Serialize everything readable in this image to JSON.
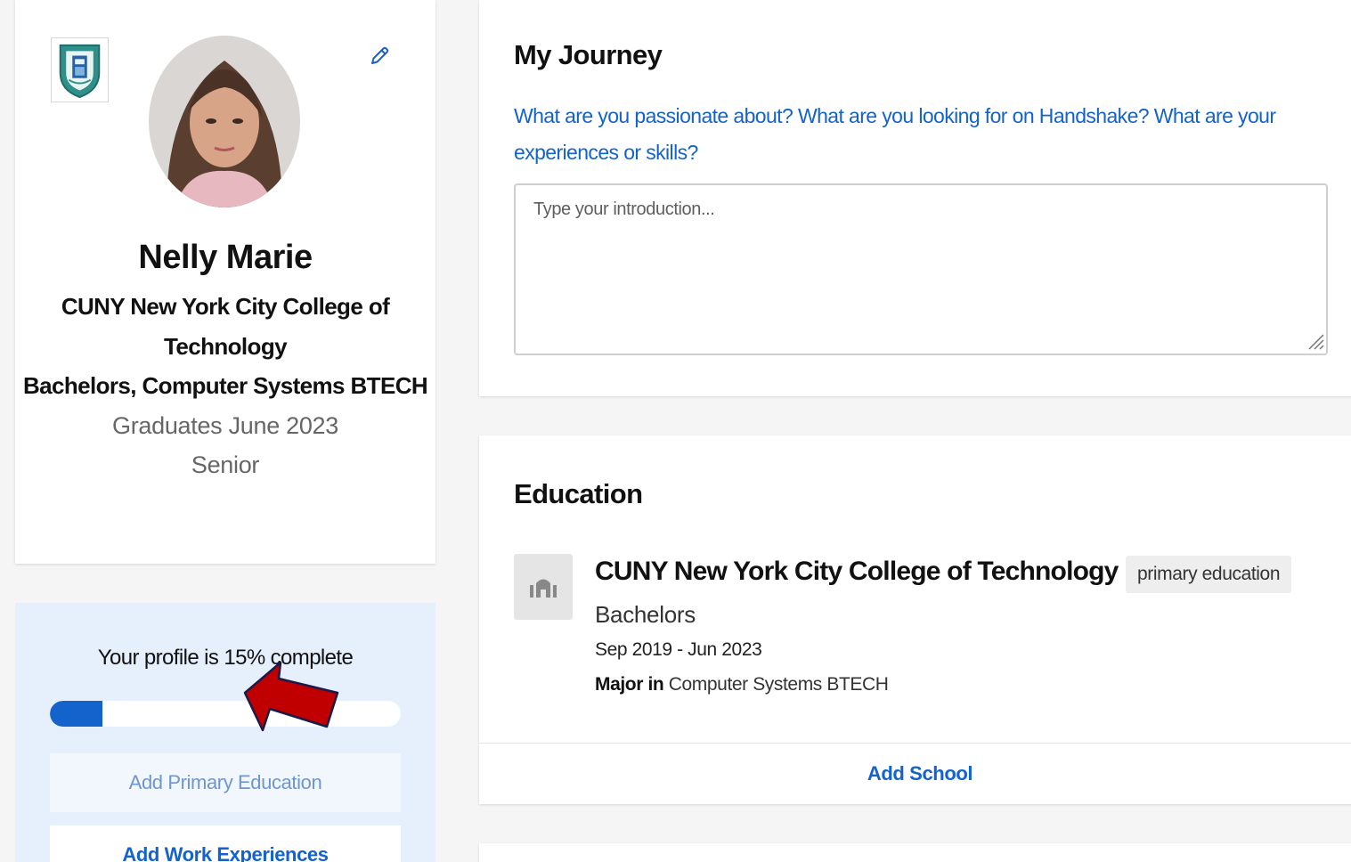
{
  "profile": {
    "name": "Nelly Marie",
    "school": "CUNY New York City College of Technology",
    "degree_major": "Bachelors, Computer Systems BTECH",
    "graduation": "Graduates June 2023",
    "class_year": "Senior",
    "edit_icon": "pencil-icon"
  },
  "completion": {
    "label": "Your profile is 15% complete",
    "percent": 15,
    "tasks": [
      "Add Primary Education",
      "Add Work Experiences"
    ]
  },
  "journey": {
    "title": "My Journey",
    "prompt": "What are you passionate about? What are you looking for on Handshake? What are your experiences or skills?",
    "placeholder": "Type your introduction..."
  },
  "education": {
    "title": "Education",
    "entries": [
      {
        "school": "CUNY New York City College of Technology",
        "tag": "primary education",
        "degree": "Bachelors",
        "dates": "Sep 2019 - Jun 2023",
        "major_prefix": "Major in",
        "major": "Computer Systems BTECH"
      }
    ],
    "add_label": "Add School"
  },
  "colors": {
    "accent": "#1462cc",
    "annotation_arrow": "#c00000",
    "progress_card_bg": "#e6f0fc"
  }
}
